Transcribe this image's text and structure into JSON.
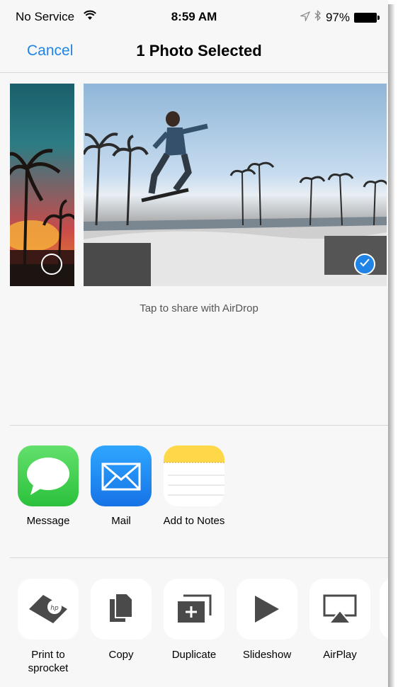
{
  "status_bar": {
    "carrier": "No Service",
    "time": "8:59 AM",
    "battery": "97%"
  },
  "nav": {
    "cancel": "Cancel",
    "title": "1 Photo Selected"
  },
  "airdrop_hint": "Tap to share with AirDrop",
  "apps": [
    {
      "label": "Message",
      "icon": "message-icon"
    },
    {
      "label": "Mail",
      "icon": "mail-icon"
    },
    {
      "label": "Add to Notes",
      "icon": "notes-icon"
    }
  ],
  "actions": [
    {
      "label": "Print to sprocket",
      "icon": "hp-sprocket-icon"
    },
    {
      "label": "Copy",
      "icon": "copy-icon"
    },
    {
      "label": "Duplicate",
      "icon": "duplicate-icon"
    },
    {
      "label": "Slideshow",
      "icon": "slideshow-icon"
    },
    {
      "label": "AirPlay",
      "icon": "airplay-icon"
    }
  ],
  "colors": {
    "accent": "#1f84e6",
    "message_green": "#4cd964",
    "mail_blue": "#1e90ff",
    "notes_yellow": "#ffd84a"
  }
}
